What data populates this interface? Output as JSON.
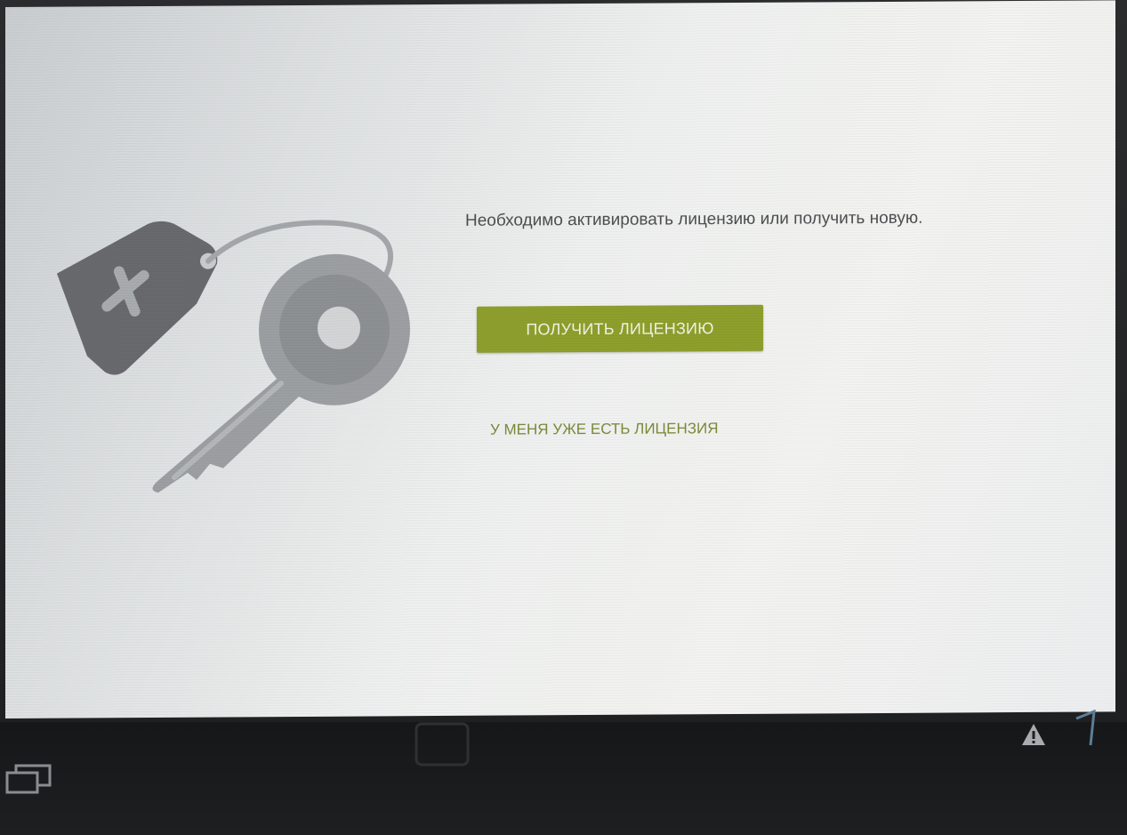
{
  "license_screen": {
    "message": "Необходимо активировать лицензию или получить новую.",
    "get_license_label": "ПОЛУЧИТЬ ЛИЦЕНЗИЮ",
    "have_license_label": "У МЕНЯ УЖЕ ЕСТЬ ЛИЦЕНЗИЯ",
    "illustration": "key-with-tag-icon"
  },
  "system_bar": {
    "icons": [
      "recent-apps-icon",
      "home-icon",
      "warning-icon",
      "signal-icon"
    ]
  },
  "colors": {
    "accent": "#8e9f2c",
    "link": "#7c8a3a",
    "text": "#4c4e50",
    "illustration": "#6b6e72"
  }
}
